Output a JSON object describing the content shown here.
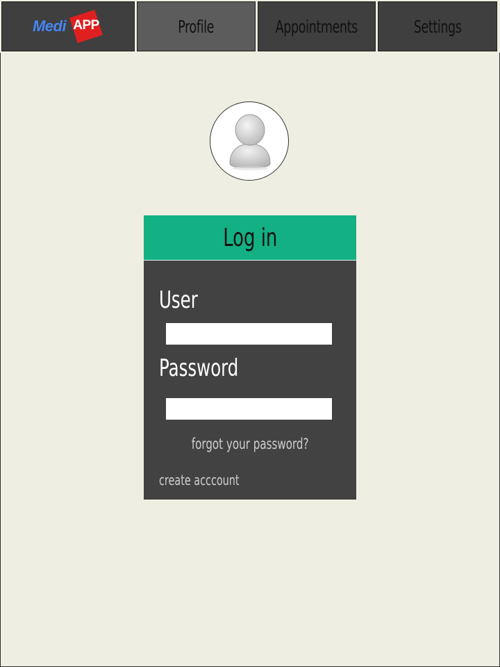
{
  "app": {
    "logo_text_medi": "Medi",
    "logo_text_app": "APP"
  },
  "nav": {
    "tabs": [
      {
        "label": "Profile",
        "active": true
      },
      {
        "label": "Appointments",
        "active": false
      },
      {
        "label": "Settings",
        "active": false
      }
    ]
  },
  "avatar": {
    "icon": "user-silhouette-icon"
  },
  "login": {
    "title": "Log in",
    "user_label": "User",
    "user_value": "",
    "password_label": "Password",
    "password_value": "",
    "forgot_link": "forgot your password?",
    "create_link": "create acccount"
  },
  "colors": {
    "background": "#efeee2",
    "nav_tile": "#3f3f3f",
    "nav_active": "#5c5c5c",
    "panel": "#424242",
    "header_accent": "#13b083",
    "logo_blue": "#4a86e8",
    "logo_red": "#e02020"
  }
}
